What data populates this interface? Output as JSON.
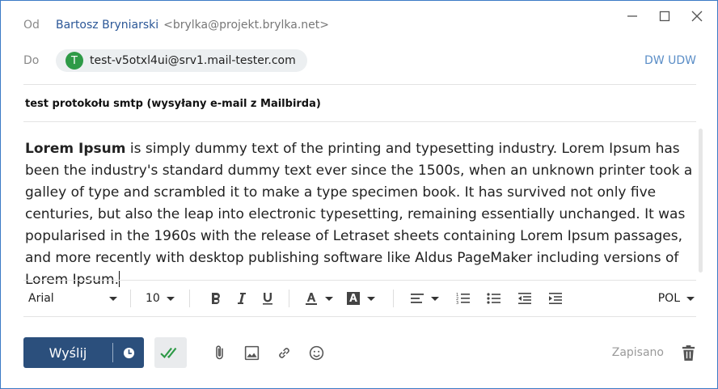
{
  "header": {
    "from_label": "Od",
    "from_name": "Bartosz Bryniarski",
    "from_email": "<brylka@projekt.brylka.net>",
    "to_label": "Do",
    "recipient_initial": "T",
    "recipient": "test-v5otxl4ui@srv1.mail-tester.com",
    "cc_bcc": "DW UDW"
  },
  "subject": "test protokołu smtp (wysyłany e-mail z Mailbirda)",
  "body": {
    "bold_lead": "Lorem Ipsum",
    "rest": " is simply dummy text of the printing and typesetting industry. Lorem Ipsum has been the industry's standard dummy text ever since the 1500s, when an unknown printer took a galley of type and scrambled it to make a type specimen book. It has survived not only five centuries, but also the leap into electronic typesetting, remaining essentially unchanged. It was popularised in the 1960s with the release of Letraset sheets containing Lorem Ipsum passages, and more recently with desktop publishing software like Aldus PageMaker including versions of Lorem Ipsum."
  },
  "toolbar": {
    "font": "Arial",
    "size": "10",
    "language": "POL"
  },
  "footer": {
    "send_label": "Wyślij",
    "saved_status": "Zapisano"
  },
  "colors": {
    "send_bg": "#2b4f7c",
    "avatar_bg": "#2e9a47",
    "accent_link": "#5b8ec7"
  },
  "icons": [
    "minimize-icon",
    "maximize-icon",
    "close-icon",
    "bold-icon",
    "italic-icon",
    "underline-icon",
    "text-color-icon",
    "highlight-icon",
    "align-icon",
    "numbered-list-icon",
    "bullet-list-icon",
    "outdent-icon",
    "indent-icon",
    "clock-icon",
    "double-check-icon",
    "paperclip-icon",
    "image-icon",
    "link-icon",
    "emoji-icon",
    "trash-icon"
  ]
}
